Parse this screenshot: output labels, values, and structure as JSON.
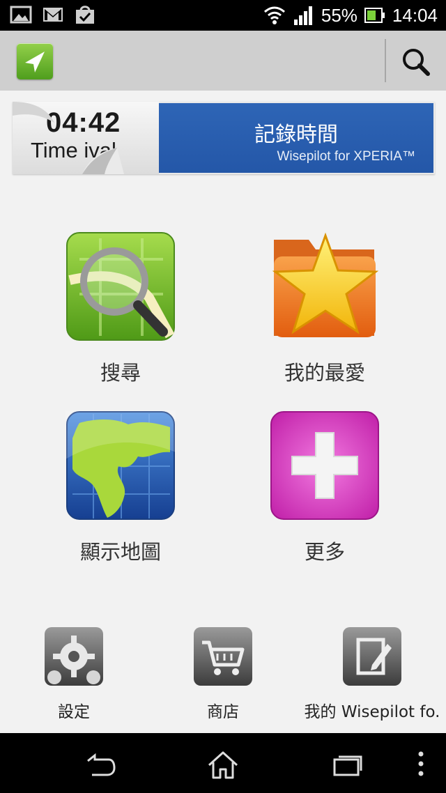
{
  "status_bar": {
    "battery_text": "55%",
    "time": "14:04",
    "notification_icons": [
      "image-icon",
      "gmail-icon",
      "shopping-bag-icon"
    ]
  },
  "action_bar": {
    "app_icon": "navigation-arrow-icon",
    "search_icon": "search-icon"
  },
  "banner": {
    "time_display": "04:42",
    "time_caption": "Time   ival",
    "title": "記錄時間",
    "subtitle": "Wisepilot for XPERIA™"
  },
  "tiles": [
    {
      "label": "搜尋",
      "icon": "search-map-icon"
    },
    {
      "label": "我的最愛",
      "icon": "favorites-star-icon"
    },
    {
      "label": "顯示地圖",
      "icon": "globe-map-icon"
    },
    {
      "label": "更多",
      "icon": "plus-icon"
    }
  ],
  "bottom": [
    {
      "label": "設定",
      "icon": "settings-gear-icon"
    },
    {
      "label": "商店",
      "icon": "shop-cart-icon"
    },
    {
      "label": "我的 Wisepilot fo.",
      "icon": "my-wisepilot-edit-icon"
    }
  ],
  "nav_bar": [
    "back-icon",
    "home-icon",
    "recent-apps-icon",
    "menu-icon"
  ]
}
